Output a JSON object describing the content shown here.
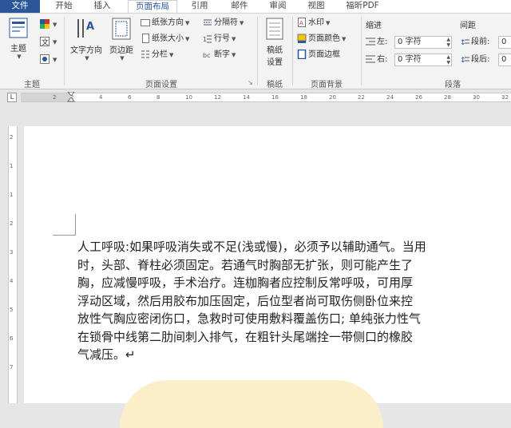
{
  "tabs": [
    "文件",
    "开始",
    "插入",
    "页面布局",
    "引用",
    "邮件",
    "审阅",
    "视图",
    "福昕PDF"
  ],
  "ribbon": {
    "theme_group": {
      "label": "主题",
      "btn_theme": "主题"
    },
    "page_setup": {
      "label": "页面设置",
      "text_direction": "文字方向",
      "margins": "页边距",
      "orientation": "纸张方向",
      "size": "纸张大小",
      "columns": "分栏",
      "breaks": "分隔符",
      "line_numbers": "行号",
      "hyphenation": "断字"
    },
    "draft": {
      "label": "稿纸",
      "btn": "稿纸\n设置",
      "btn_l1": "稿纸",
      "btn_l2": "设置"
    },
    "page_bg": {
      "label": "页面背景",
      "watermark": "水印",
      "page_color": "页面颜色",
      "page_border": "页面边框"
    },
    "paragraph": {
      "label": "段落",
      "indent_title": "缩进",
      "spacing_title": "间距",
      "left_label": "左:",
      "right_label": "右:",
      "left_value": "0 字符",
      "right_value": "0 字符",
      "before_label": "段前:",
      "after_label": "段后:",
      "before_value": "0",
      "after_value": "0"
    }
  },
  "ruler": {
    "numbers": [
      "2",
      "2",
      "4",
      "6",
      "8",
      "10",
      "12",
      "14",
      "16",
      "18",
      "20",
      "22",
      "24",
      "26",
      "28",
      "30",
      "32"
    ]
  },
  "vruler": {
    "numbers": [
      "2",
      "1",
      "1",
      "2",
      "3",
      "4",
      "5",
      "6",
      "7"
    ]
  },
  "document": {
    "lines": [
      "人工呼吸:如果呼吸消失或不足(浅或慢)，必须予以辅助通气。当用",
      "时，头部、脊柱必须固定。若通气时胸部无扩张，则可能产生了",
      "胸，应减慢呼吸，手术治疗。连枷胸者应控制反常呼吸，可用厚",
      "浮动区域，然后用胶布加压固定，后位型者尚可取伤侧卧位来控",
      "放性气胸应密闭伤口，急救时可使用敷料覆盖伤口; 单纯张力性气",
      "在锁骨中线第二肋间刺入排气，在粗针头尾端拴一带侧口的橡胶",
      "气减压。↵"
    ]
  }
}
